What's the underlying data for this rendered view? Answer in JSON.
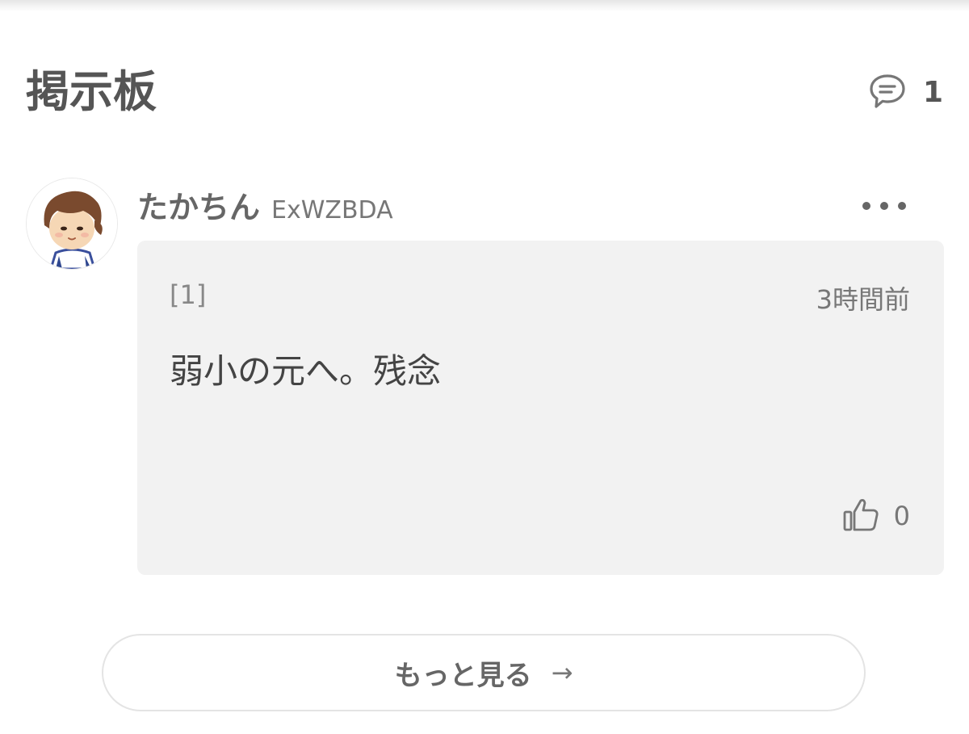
{
  "header": {
    "title": "掲示板",
    "comment_count": "1",
    "comment_icon": "speech-bubble-icon"
  },
  "post": {
    "user_name": "たかちん",
    "user_id": "ExWZBDA",
    "avatar_icon": "boy-avatar-icon",
    "menu_icon": "more-dots-icon",
    "number": "[1]",
    "time": "3時間前",
    "body": "弱小の元へ。残念",
    "like_icon": "thumbs-up-icon",
    "like_count": "0"
  },
  "more_button": {
    "label": "もっと見る",
    "arrow": "→"
  }
}
